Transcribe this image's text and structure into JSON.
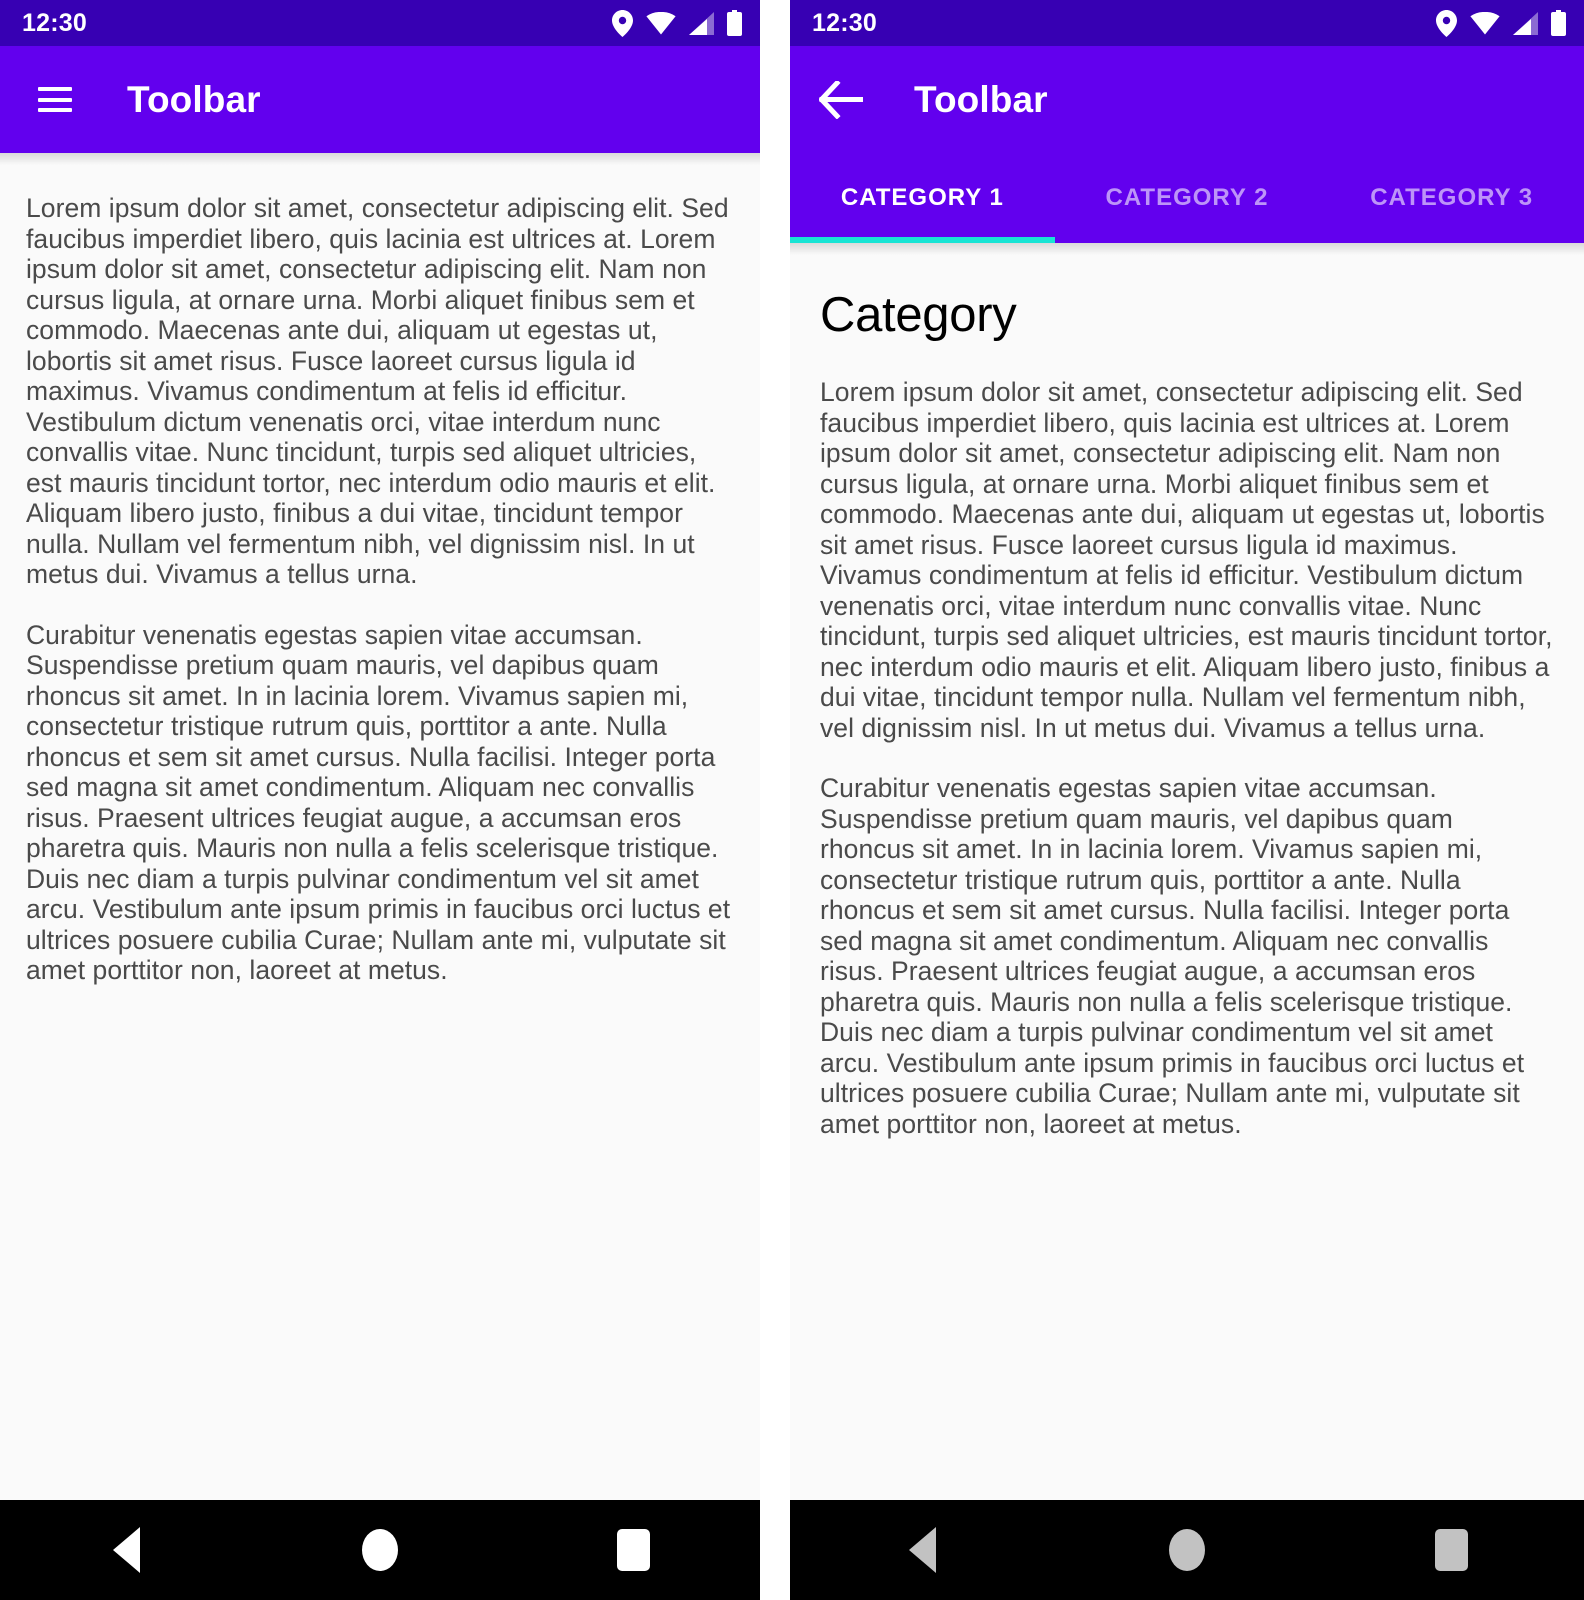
{
  "status_bar": {
    "time": "12:30",
    "icons": [
      "location-pin-icon",
      "wifi-icon",
      "cellular-signal-icon",
      "battery-icon"
    ]
  },
  "colors": {
    "status_bar_bg": "#3700B3",
    "toolbar_bg": "#6200EE",
    "tab_indicator": "#18E4D4",
    "content_bg": "#FAFAFA",
    "body_text": "#4A4A4A",
    "nav_bar_bg": "#000000",
    "nav_icon_left": "#FFFFFF",
    "nav_icon_right": "#C2C2C2"
  },
  "left_panel": {
    "toolbar": {
      "menu_icon": "hamburger-menu-icon",
      "title": "Toolbar"
    },
    "paragraphs": [
      "Lorem ipsum dolor sit amet, consectetur adipiscing elit. Sed faucibus imperdiet libero, quis lacinia est ultrices at. Lorem ipsum dolor sit amet, consectetur adipiscing elit. Nam non cursus ligula, at ornare urna. Morbi aliquet finibus sem et commodo. Maecenas ante dui, aliquam ut egestas ut, lobortis sit amet risus. Fusce laoreet cursus ligula id maximus. Vivamus condimentum at felis id efficitur. Vestibulum dictum venenatis orci, vitae interdum nunc convallis vitae. Nunc tincidunt, turpis sed aliquet ultricies, est mauris tincidunt tortor, nec interdum odio mauris et elit. Aliquam libero justo, finibus a dui vitae, tincidunt tempor nulla. Nullam vel fermentum nibh, vel dignissim nisl. In ut metus dui. Vivamus a tellus urna.",
      "Curabitur venenatis egestas sapien vitae accumsan. Suspendisse pretium quam mauris, vel dapibus quam rhoncus sit amet. In in lacinia lorem. Vivamus sapien mi, consectetur tristique rutrum quis, porttitor a ante. Nulla rhoncus et sem sit amet cursus. Nulla facilisi. Integer porta sed magna sit amet condimentum. Aliquam nec convallis risus. Praesent ultrices feugiat augue, a accumsan eros pharetra quis. Mauris non nulla a felis scelerisque tristique. Duis nec diam a turpis pulvinar condimentum vel sit amet arcu. Vestibulum ante ipsum primis in faucibus orci luctus et ultrices posuere cubilia Curae; Nullam ante mi, vulputate sit amet porttitor non, laoreet at metus."
    ],
    "nav_bar": {
      "back": "back-triangle-icon",
      "home": "home-circle-icon",
      "recents": "recents-square-icon"
    }
  },
  "right_panel": {
    "toolbar": {
      "back_icon": "back-arrow-icon",
      "title": "Toolbar"
    },
    "tabs": [
      {
        "label": "CATEGORY 1",
        "active": true
      },
      {
        "label": "CATEGORY 2",
        "active": false
      },
      {
        "label": "CATEGORY 3",
        "active": false
      }
    ],
    "heading": "Category",
    "paragraphs": [
      "Lorem ipsum dolor sit amet, consectetur adipiscing elit. Sed faucibus imperdiet libero, quis lacinia est ultrices at. Lorem ipsum dolor sit amet, consectetur adipiscing elit. Nam non cursus ligula, at ornare urna. Morbi aliquet finibus sem et commodo. Maecenas ante dui, aliquam ut egestas ut, lobortis sit amet risus. Fusce laoreet cursus ligula id maximus. Vivamus condimentum at felis id efficitur. Vestibulum dictum venenatis orci, vitae interdum nunc convallis vitae. Nunc tincidunt, turpis sed aliquet ultricies, est mauris tincidunt tortor, nec interdum odio mauris et elit. Aliquam libero justo, finibus a dui vitae, tincidunt tempor nulla. Nullam vel fermentum nibh, vel dignissim nisl. In ut metus dui. Vivamus a tellus urna.",
      "Curabitur venenatis egestas sapien vitae accumsan. Suspendisse pretium quam mauris, vel dapibus quam rhoncus sit amet. In in lacinia lorem. Vivamus sapien mi, consectetur tristique rutrum quis, porttitor a ante. Nulla rhoncus et sem sit amet cursus. Nulla facilisi. Integer porta sed magna sit amet condimentum. Aliquam nec convallis risus. Praesent ultrices feugiat augue, a accumsan eros pharetra quis. Mauris non nulla a felis scelerisque tristique. Duis nec diam a turpis pulvinar condimentum vel sit amet arcu. Vestibulum ante ipsum primis in faucibus orci luctus et ultrices posuere cubilia Curae; Nullam ante mi, vulputate sit amet porttitor non, laoreet at metus."
    ],
    "nav_bar": {
      "back": "back-triangle-icon",
      "home": "home-circle-icon",
      "recents": "recents-square-icon"
    }
  }
}
